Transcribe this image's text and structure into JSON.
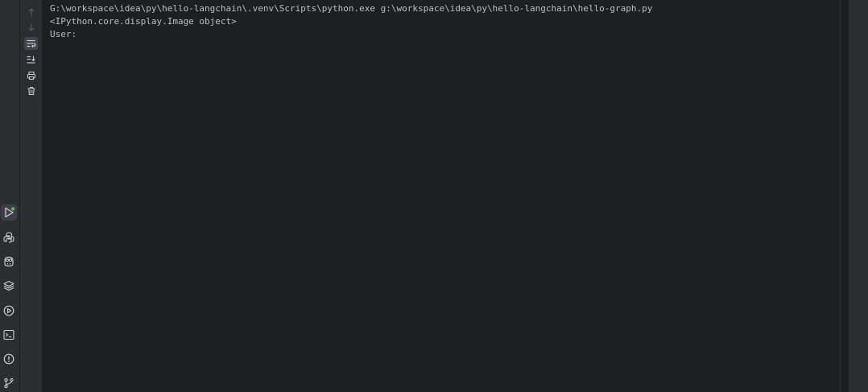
{
  "console": {
    "lines": [
      "G:\\workspace\\idea\\py\\hello-langchain\\.venv\\Scripts\\python.exe g:\\workspace\\idea\\py\\hello-langchain\\hello-graph.py",
      "<IPython.core.display.Image object>",
      "User: "
    ]
  },
  "toolbar": {
    "icons": [
      "up-arrow-icon",
      "down-arrow-icon",
      "soft-wrap-icon",
      "scroll-to-end-icon",
      "print-icon",
      "trash-icon"
    ]
  },
  "left_stripe": {
    "icons": [
      "run-icon",
      "python-console-icon",
      "copilot-icon",
      "layers-icon",
      "services-icon",
      "terminal-icon",
      "problems-icon",
      "git-branch-icon"
    ],
    "active": "run-icon"
  },
  "colors": {
    "background": "#1e1f22",
    "panel": "#2b2d30",
    "text": "#bcbec4",
    "icon": "#ced0d6",
    "icon_disabled": "#5a5d63"
  }
}
